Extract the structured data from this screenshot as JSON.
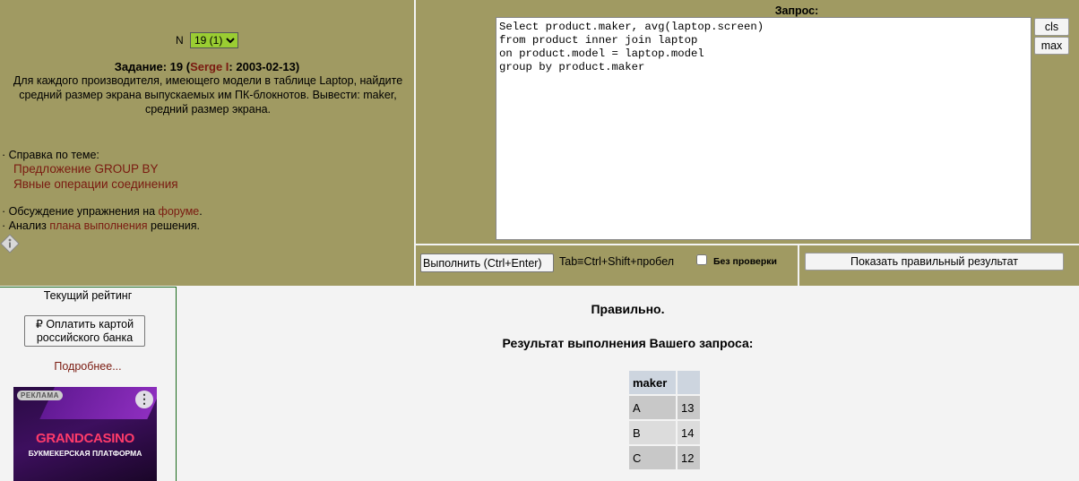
{
  "task": {
    "n_label": "N",
    "n_selected": "19 (1)",
    "title_prefix": "Задание: 19 (",
    "author": "Serge I",
    "title_suffix": ": 2003-02-13)",
    "text": "Для каждого производителя, имеющего модели в таблице Laptop, найдите средний размер экрана выпускаемых им ПК-блокнотов. Вывести: maker, средний размер экрана.",
    "help_title": "· Справка по теме:",
    "help_link_1": "Предложение GROUP BY",
    "help_link_2": "Явные операции соединения",
    "forum_prefix": "· Обсуждение упражнения на ",
    "forum_link": "форуме",
    "forum_suffix": ".",
    "plan_prefix": "· Анализ ",
    "plan_link": "плана выполнения",
    "plan_suffix": " решения."
  },
  "query": {
    "label": "Запрос:",
    "text": "Select product.maker, avg(laptop.screen)\nfrom product inner join laptop\non product.model = laptop.model\ngroup by product.maker",
    "cls_label": "cls",
    "max_label": "max"
  },
  "exec": {
    "run_label": "Выполнить (Ctrl+Enter)",
    "tab_hint": "Tab≡Ctrl+Shift+пробел",
    "nocheck_label": "Без  проверки",
    "show_result_label": "Показать правильный результат"
  },
  "rating": {
    "title": "Текущий рейтинг",
    "pay_label": "₽ Оплатить картой российского банка",
    "more_label": "Подробнее...",
    "ad_tag": "РЕКЛАМА",
    "ad_brand": "GRANDCASINO",
    "ad_sub": "БУКМЕКЕРСКАЯ ПЛАТФОРМА"
  },
  "result": {
    "status": "Правильно.",
    "title": "Результат выполнения Вашего запроса:",
    "columns": [
      "maker",
      ""
    ],
    "rows": [
      [
        "A",
        "13"
      ],
      [
        "B",
        "14"
      ],
      [
        "C",
        "12"
      ]
    ]
  }
}
